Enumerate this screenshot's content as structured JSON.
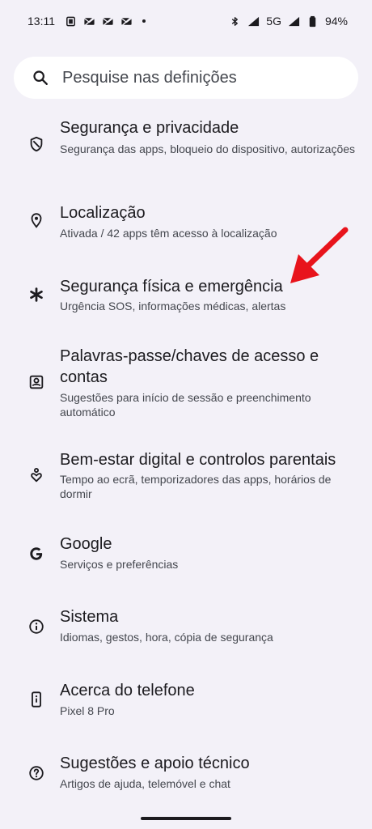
{
  "status_bar": {
    "time": "13:11",
    "network": "5G",
    "battery": "94%"
  },
  "search": {
    "placeholder": "Pesquise nas definições"
  },
  "items": [
    {
      "icon": "shield-icon",
      "title": "Segurança e privacidade",
      "subtitle": "Segurança das apps, bloqueio do dispositivo, autorizações"
    },
    {
      "icon": "location-pin-icon",
      "title": "Localização",
      "subtitle": "Ativada / 42 apps têm acesso à localização"
    },
    {
      "icon": "asterisk-icon",
      "title": "Segurança física e emergência",
      "subtitle": "Urgência SOS, informações médicas, alertas"
    },
    {
      "icon": "account-box-icon",
      "title": "Palavras-passe/chaves de acesso e contas",
      "subtitle": "Sugestões para início de sessão e preenchimento automático"
    },
    {
      "icon": "wellbeing-heart-icon",
      "title": "Bem-estar digital e controlos parentais",
      "subtitle": "Tempo ao ecrã, temporizadores das apps, horários de dormir"
    },
    {
      "icon": "google-g-icon",
      "title": "Google",
      "subtitle": "Serviços e preferências"
    },
    {
      "icon": "info-icon",
      "title": "Sistema",
      "subtitle": "Idiomas, gestos, hora, cópia de segurança"
    },
    {
      "icon": "phone-info-icon",
      "title": "Acerca do telefone",
      "subtitle": "Pixel 8 Pro"
    },
    {
      "icon": "help-icon",
      "title": "Sugestões e apoio técnico",
      "subtitle": "Artigos de ajuda, telemóvel e chat"
    }
  ],
  "colors": {
    "background": "#f3f1f8",
    "text_primary": "#1c1b1f",
    "text_secondary": "#44474e",
    "annotation_arrow": "#e8141c"
  }
}
